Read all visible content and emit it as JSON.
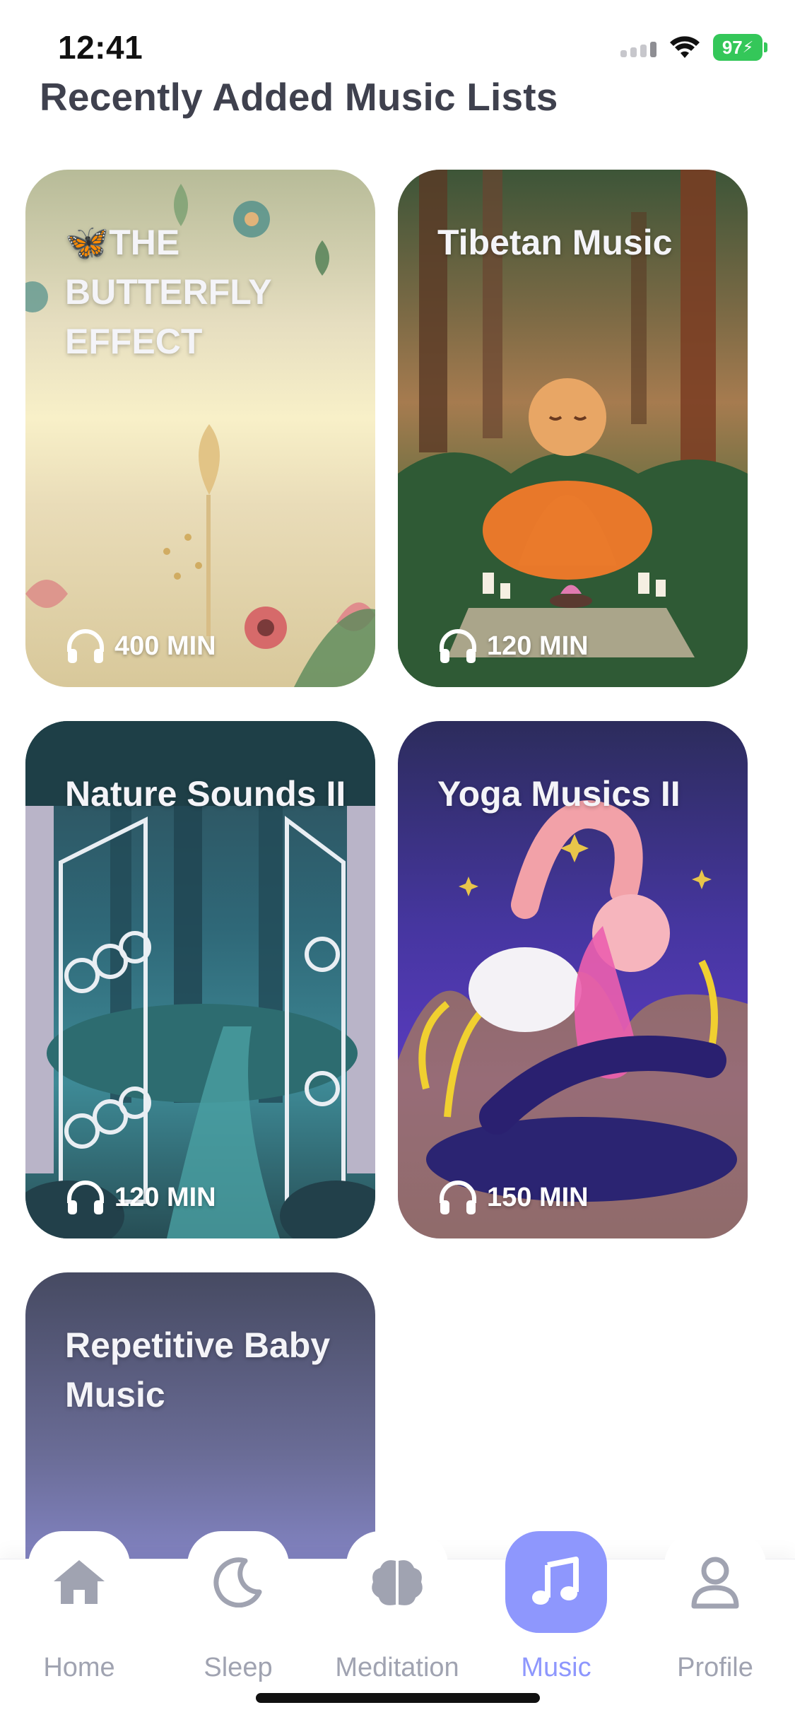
{
  "status_bar": {
    "time": "12:41",
    "battery": "97"
  },
  "page": {
    "title": "Recently Added Music Lists"
  },
  "cards": [
    {
      "title": "🦋THE BUTTERFLY EFFECT",
      "duration": "400 MIN"
    },
    {
      "title": "Tibetan Music",
      "duration": "120 MIN"
    },
    {
      "title": "Nature Sounds II",
      "duration": "120 MIN"
    },
    {
      "title": "Yoga Musics II",
      "duration": "150 MIN"
    },
    {
      "title": "Repetitive Baby Music"
    }
  ],
  "tabs": [
    {
      "label": "Home",
      "icon": "home-icon"
    },
    {
      "label": "Sleep",
      "icon": "moon-icon"
    },
    {
      "label": "Meditation",
      "icon": "brain-icon"
    },
    {
      "label": "Music",
      "icon": "music-note-icon",
      "active": true
    },
    {
      "label": "Profile",
      "icon": "profile-icon"
    }
  ],
  "colors": {
    "accent": "#8e97fd",
    "inactive": "#a0a3b1",
    "title": "#3f414e",
    "battery": "#34c759"
  }
}
